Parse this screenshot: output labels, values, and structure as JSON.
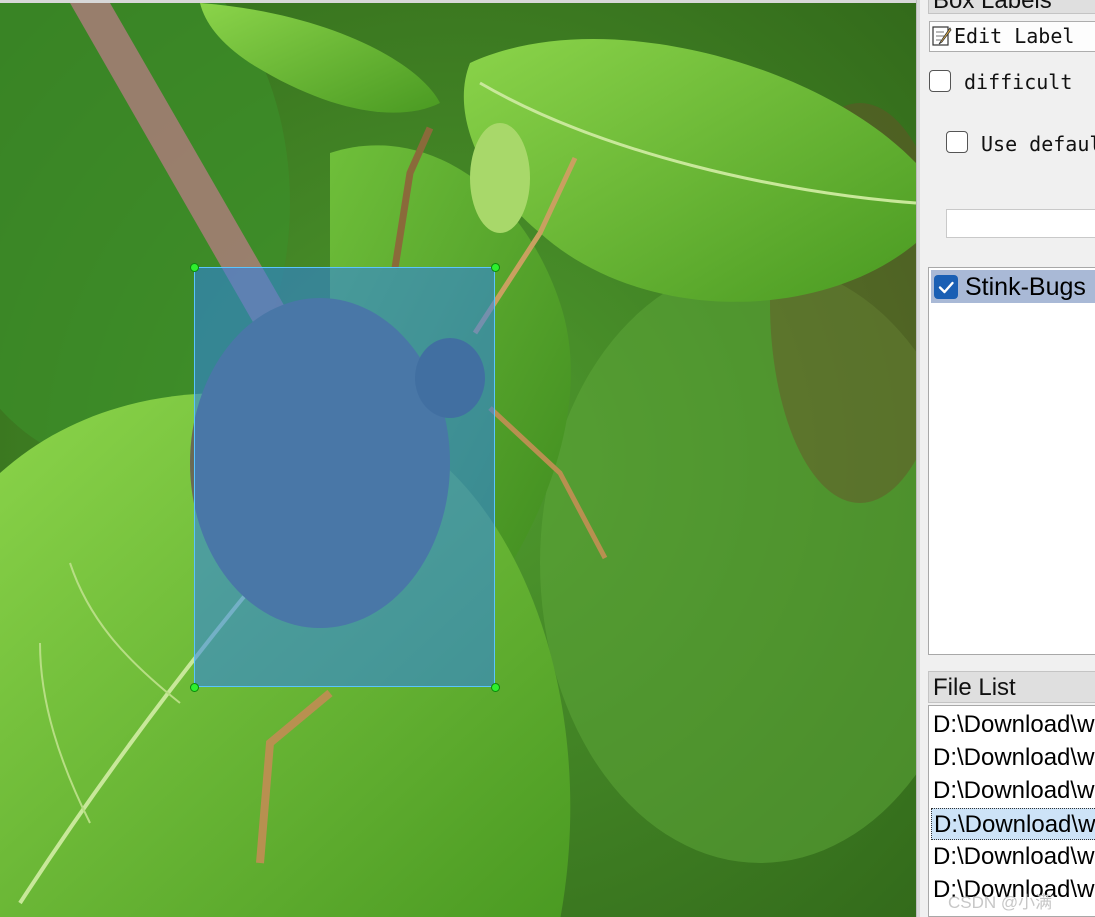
{
  "panels": {
    "box_labels_title": "Box Labels",
    "file_list_title": "File List"
  },
  "controls": {
    "edit_label": "Edit Label",
    "difficult": "difficult",
    "use_default_label": "Use default label",
    "default_label_value": ""
  },
  "labels": [
    {
      "name": "Stink-Bugs",
      "checked": true
    }
  ],
  "files": [
    {
      "path": "D:\\Download\\w",
      "selected": false
    },
    {
      "path": "D:\\Download\\w",
      "selected": false
    },
    {
      "path": "D:\\Download\\w",
      "selected": false
    },
    {
      "path": "D:\\Download\\w",
      "selected": true
    },
    {
      "path": "D:\\Download\\w",
      "selected": false
    },
    {
      "path": "D:\\Download\\w",
      "selected": false
    }
  ],
  "annotation": {
    "label": "Stink-Bugs",
    "fill_color": "#2d82eb",
    "vertex_color": "#2ef02e"
  },
  "watermark": "CSDN @小满"
}
